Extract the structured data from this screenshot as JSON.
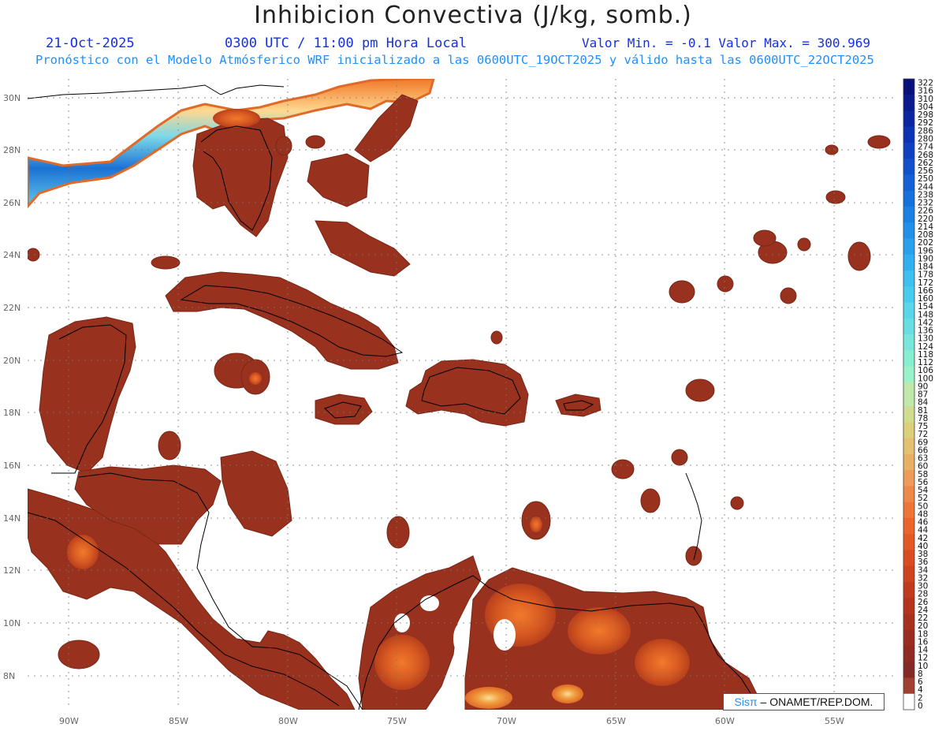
{
  "header": {
    "title": "Inhibicion Convectiva (J/kg, somb.)",
    "date": "21-Oct-2025",
    "time": "0300 UTC / 11:00 pm Hora Local",
    "minmax": "Valor Min. = -0.1  Valor Max. = 300.969",
    "subtitle": "Pronóstico con el Modelo Atmósferico WRF inicializado a las 0600UTC_19OCT2025 y válido hasta las  0600UTC_22OCT2025"
  },
  "map": {
    "lon_range": [
      -92,
      -50
    ],
    "lat_range": [
      6.8,
      30.6
    ],
    "lat_ticks": [
      "30N",
      "28N",
      "26N",
      "24N",
      "22N",
      "20N",
      "18N",
      "16N",
      "14N",
      "12N",
      "10N",
      "8N"
    ],
    "lon_ticks": [
      "90W",
      "85W",
      "80W",
      "75W",
      "70W",
      "65W",
      "60W",
      "55W"
    ]
  },
  "legend": {
    "labels": [
      "322",
      "316",
      "310",
      "304",
      "298",
      "292",
      "286",
      "280",
      "274",
      "268",
      "262",
      "256",
      "250",
      "244",
      "238",
      "232",
      "226",
      "220",
      "214",
      "208",
      "202",
      "196",
      "190",
      "184",
      "178",
      "172",
      "166",
      "160",
      "154",
      "148",
      "142",
      "136",
      "130",
      "124",
      "118",
      "112",
      "106",
      "100",
      "90",
      "87",
      "84",
      "81",
      "78",
      "75",
      "72",
      "69",
      "66",
      "63",
      "60",
      "58",
      "56",
      "54",
      "52",
      "50",
      "48",
      "46",
      "44",
      "42",
      "40",
      "38",
      "36",
      "34",
      "32",
      "30",
      "28",
      "26",
      "24",
      "22",
      "20",
      "18",
      "16",
      "14",
      "12",
      "10",
      "8",
      "6",
      "4",
      "2",
      "0"
    ],
    "colors": [
      "#08107a",
      "#0a1a8e",
      "#0c26a2",
      "#0e32b4",
      "#1040c2",
      "#1050cc",
      "#1260d4",
      "#1470dc",
      "#1a80e4",
      "#2090ea",
      "#28a0ee",
      "#30b0f0",
      "#3cc0f0",
      "#48ccee",
      "#58d6ea",
      "#68dee2",
      "#78e6da",
      "#88eed2",
      "#9af2ca",
      "#c0e8a8",
      "#d0dc90",
      "#dcd07c",
      "#e4c070",
      "#e8b064",
      "#ec9c58",
      "#ee8848",
      "#ee7438",
      "#ea642c",
      "#e45824",
      "#da4c20",
      "#ce421e",
      "#c23a1e",
      "#b4341e",
      "#a8301e",
      "#9c2c20",
      "#902a22",
      "#842a26",
      "#a04030",
      "#ffffff"
    ],
    "color_note": "dark blue at top through cyan, pale green, tan, orange to dark red near zero; white at 0"
  },
  "credit": {
    "brand": "Sisπ",
    "text": "– ONAMET/REP.DOM."
  }
}
